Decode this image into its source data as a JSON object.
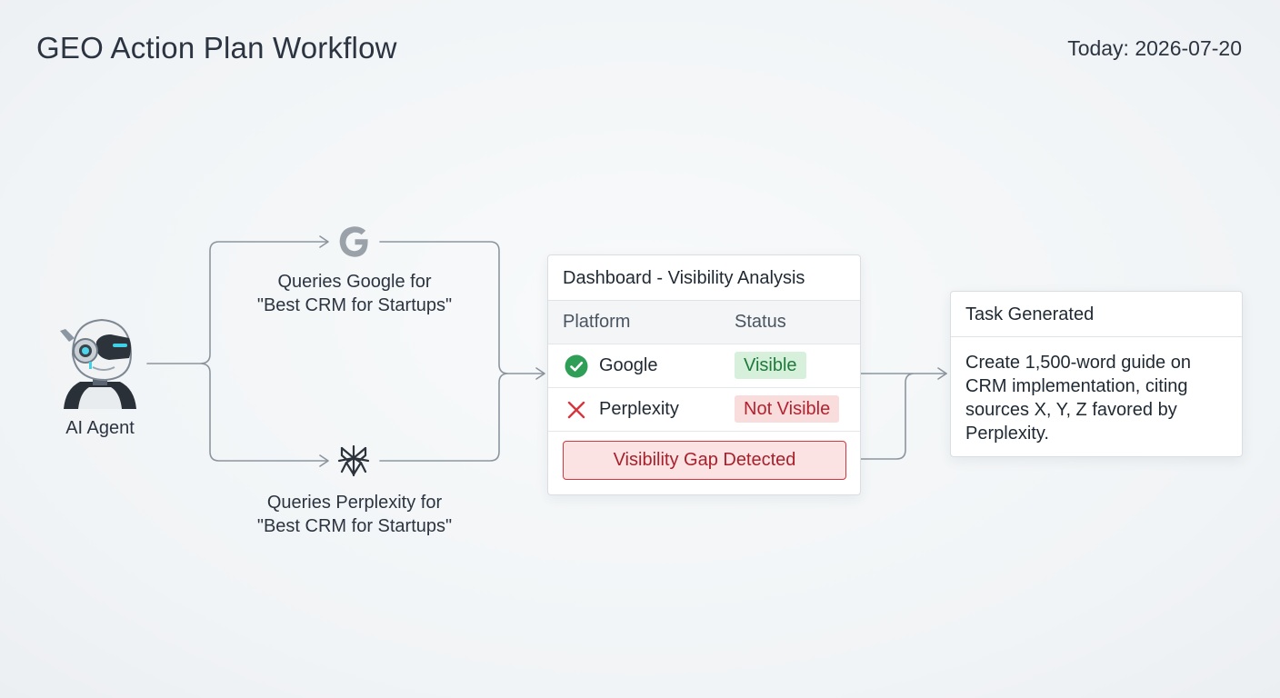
{
  "header": {
    "title": "GEO Action Plan Workflow",
    "date_label": "Today: 2026-07-20"
  },
  "agent": {
    "label": "AI Agent",
    "icon": "robot-icon"
  },
  "queries": [
    {
      "engine": "Google",
      "icon": "google-logo-icon",
      "line1": "Queries Google for",
      "line2": "\"Best CRM for Startups\""
    },
    {
      "engine": "Perplexity",
      "icon": "perplexity-logo-icon",
      "line1": "Queries Perplexity for",
      "line2": "\"Best CRM for Startups\""
    }
  ],
  "dashboard": {
    "title": "Dashboard - Visibility Analysis",
    "columns": [
      "Platform",
      "Status"
    ],
    "rows": [
      {
        "platform": "Google",
        "status": "Visible",
        "icon": "check-circle-icon",
        "status_color": "#1f7a3a"
      },
      {
        "platform": "Perplexity",
        "status": "Not Visible",
        "icon": "x-mark-icon",
        "status_color": "#b3232f"
      }
    ],
    "alert": "Visibility Gap Detected"
  },
  "task": {
    "title": "Task Generated",
    "body": "Create 1,500-word guide on CRM implementation, citing sources X, Y, Z favored by Perplexity."
  },
  "colors": {
    "connector": "#8c959f",
    "success": "#2f9e57",
    "danger": "#d6363f"
  }
}
